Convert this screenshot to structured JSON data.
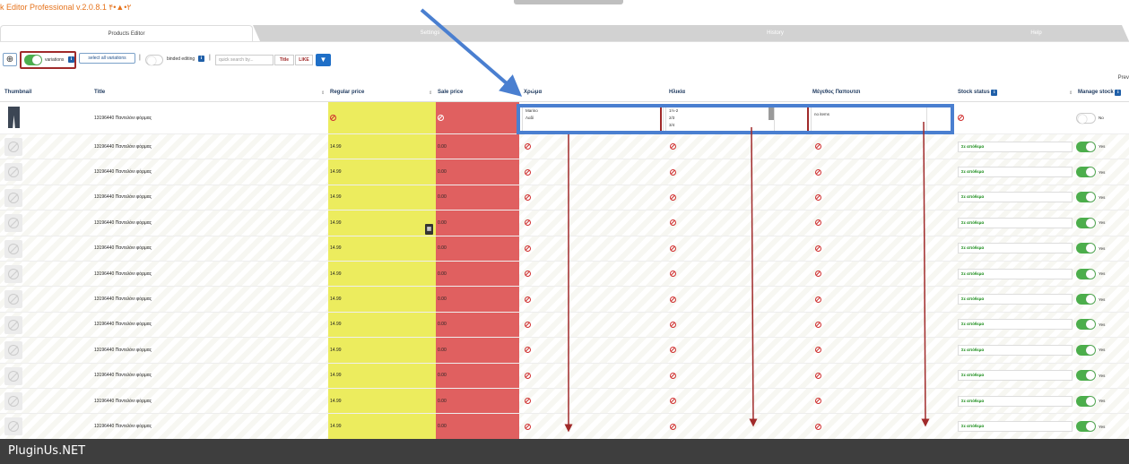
{
  "app": {
    "title": "k Editor Professional v.2.0.8.1 ۴•▲•۲"
  },
  "tabs": [
    {
      "label": "Products Editor",
      "active": true
    },
    {
      "label": "Settings",
      "active": false
    },
    {
      "label": "History",
      "active": false
    },
    {
      "label": "Help",
      "active": false
    }
  ],
  "toolbar": {
    "variations_label": "variations",
    "select_all_label": "select all variations",
    "separator": "|",
    "binded_label": "binded editing",
    "search_placeholder": "quick search by...",
    "search_mode_1": "Title",
    "search_mode_2": "LIKE",
    "info_glyph": "i"
  },
  "prev_label": "Prev",
  "columns": {
    "thumbnail": "Thumbnail",
    "title": "Title",
    "regular_price": "Regular price",
    "sale_price": "Sale price",
    "color": "Χρώμα",
    "age": "Ηλικία",
    "size": "Μέγεθος Παπουτσι",
    "stock_status": "Stock status",
    "manage_stock": "Manage stock"
  },
  "first_row": {
    "title": "13196440 Παντελόνι φόρμας",
    "colors": [
      "Marino",
      "Λαδί"
    ],
    "ages": [
      "1½-2",
      "2/3",
      "3/4"
    ],
    "size_value": "no items",
    "manage_label": "No"
  },
  "rows": [
    {
      "title": "13196440 Παντελόνι φόρμας",
      "regular": "14.99",
      "sale": "0.00",
      "stock": "Σε απόθεμα",
      "manage": "Yes"
    },
    {
      "title": "13196440 Παντελόνι φόρμας",
      "regular": "14.99",
      "sale": "0.00",
      "stock": "Σε απόθεμα",
      "manage": "Yes"
    },
    {
      "title": "13196440 Παντελόνι φόρμας",
      "regular": "14.99",
      "sale": "0.00",
      "stock": "Σε απόθεμα",
      "manage": "Yes"
    },
    {
      "title": "13196440 Παντελόνι φόρμας",
      "regular": "14.99",
      "sale": "0.00",
      "stock": "Σε απόθεμα",
      "manage": "Yes"
    },
    {
      "title": "13196440 Παντελόνι φόρμας",
      "regular": "14.99",
      "sale": "0.00",
      "stock": "Σε απόθεμα",
      "manage": "Yes"
    },
    {
      "title": "13196440 Παντελόνι φόρμας",
      "regular": "14.99",
      "sale": "0.00",
      "stock": "Σε απόθεμα",
      "manage": "Yes"
    },
    {
      "title": "13196440 Παντελόνι φόρμας",
      "regular": "14.99",
      "sale": "0.00",
      "stock": "Σε απόθεμα",
      "manage": "Yes"
    },
    {
      "title": "13196440 Παντελόνι φόρμας",
      "regular": "14.99",
      "sale": "0.00",
      "stock": "Σε απόθεμα",
      "manage": "Yes"
    },
    {
      "title": "13196440 Παντελόνι φόρμας",
      "regular": "14.99",
      "sale": "0.00",
      "stock": "Σε απόθεμα",
      "manage": "Yes"
    },
    {
      "title": "13196440 Παντελόνι φόρμας",
      "regular": "14.99",
      "sale": "0.00",
      "stock": "Σε απόθεμα",
      "manage": "Yes"
    },
    {
      "title": "13196440 Παντελόνι φόρμας",
      "regular": "14.99",
      "sale": "0.00",
      "stock": "Σε απόθεμα",
      "manage": "Yes"
    },
    {
      "title": "13196440 Παντελόνι φόρμας",
      "regular": "14.99",
      "sale": "0.00",
      "stock": "Σε απόθεμα",
      "manage": "Yes"
    }
  ],
  "footer": {
    "text": "PluginUs.NET"
  },
  "colors": {
    "regular_price_bg": "#ecec5e",
    "sale_price_bg": "#e06060",
    "annotation_blue": "#4a7fd0",
    "annotation_red": "#a02a2a",
    "toggle_on": "#4cae4c"
  },
  "icons": {
    "calculator": "▦"
  }
}
